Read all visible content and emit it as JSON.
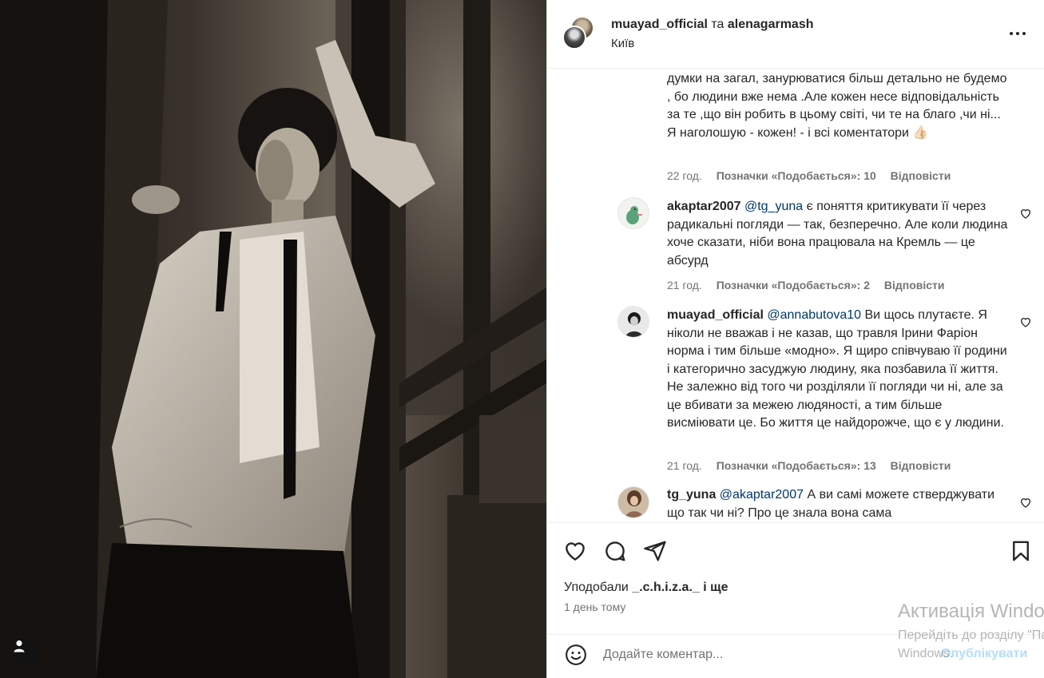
{
  "header": {
    "user1": "muayad_official",
    "joiner": "та",
    "user2": "alenagarmash",
    "location": "Київ"
  },
  "comments": [
    {
      "user": "",
      "mention": "",
      "text": "думки на загал, занурюватися більш детально не будемо , бо людини вже нема .Але кожен несе відповідальність за те ,що він робить в цьому світі, чи те на благо ,чи ні... Я наголошую - кожен! - і всі коментатори 👍🏻",
      "time": "22 год.",
      "likes": "Позначки «Подобається»: 10",
      "reply": "Відповісти"
    },
    {
      "user": "akaptar2007",
      "mention": "@tg_yuna",
      "text": " є поняття критикувати її через радикальні погляди — так, безперечно. Але коли людина хоче сказати, ніби вона працювала на Кремль — це абсурд",
      "time": "21 год.",
      "likes": "Позначки «Подобається»: 2",
      "reply": "Відповісти"
    },
    {
      "user": "muayad_official",
      "mention": "@annabutova10",
      "text": " Ви щось плутаєте. Я ніколи не вважав і не казав, що травля Ірини Фаріон норма і тим більше «модно». Я щиро співчуваю її родини і категорично засуджую людину, яка позбавила її життя. Не залежно від того чи розділяли її погляди чи ні, але за це вбивати за межею людяності, а тим більше висміювати це. Бо життя це найдорожче, що є у людини.",
      "time": "21 год.",
      "likes": "Позначки «Подобається»: 13",
      "reply": "Відповісти"
    },
    {
      "user": "tg_yuna",
      "mention": "@akaptar2007",
      "text": " А ви самі можете стверджувати що так чи ні? Про це знала вона сама",
      "time": "",
      "likes": "",
      "reply": ""
    }
  ],
  "liked_by": {
    "prefix": "Уподобали",
    "user": "_.c.h.i.z.a._",
    "suffix": "і ще"
  },
  "post_time": "1 день тому",
  "add_comment": {
    "placeholder": "Додайте коментар...",
    "publish": "Опублікувати"
  },
  "watermark": {
    "line1": "Активація Windows",
    "line2": "Перейдіть до розділу \"Параметри\", щоб активувати",
    "line3": "Windows."
  },
  "icons": [
    "heart-icon",
    "comment-icon",
    "share-icon",
    "bookmark-icon",
    "emoji-icon",
    "more-icon",
    "user-tag-icon"
  ]
}
